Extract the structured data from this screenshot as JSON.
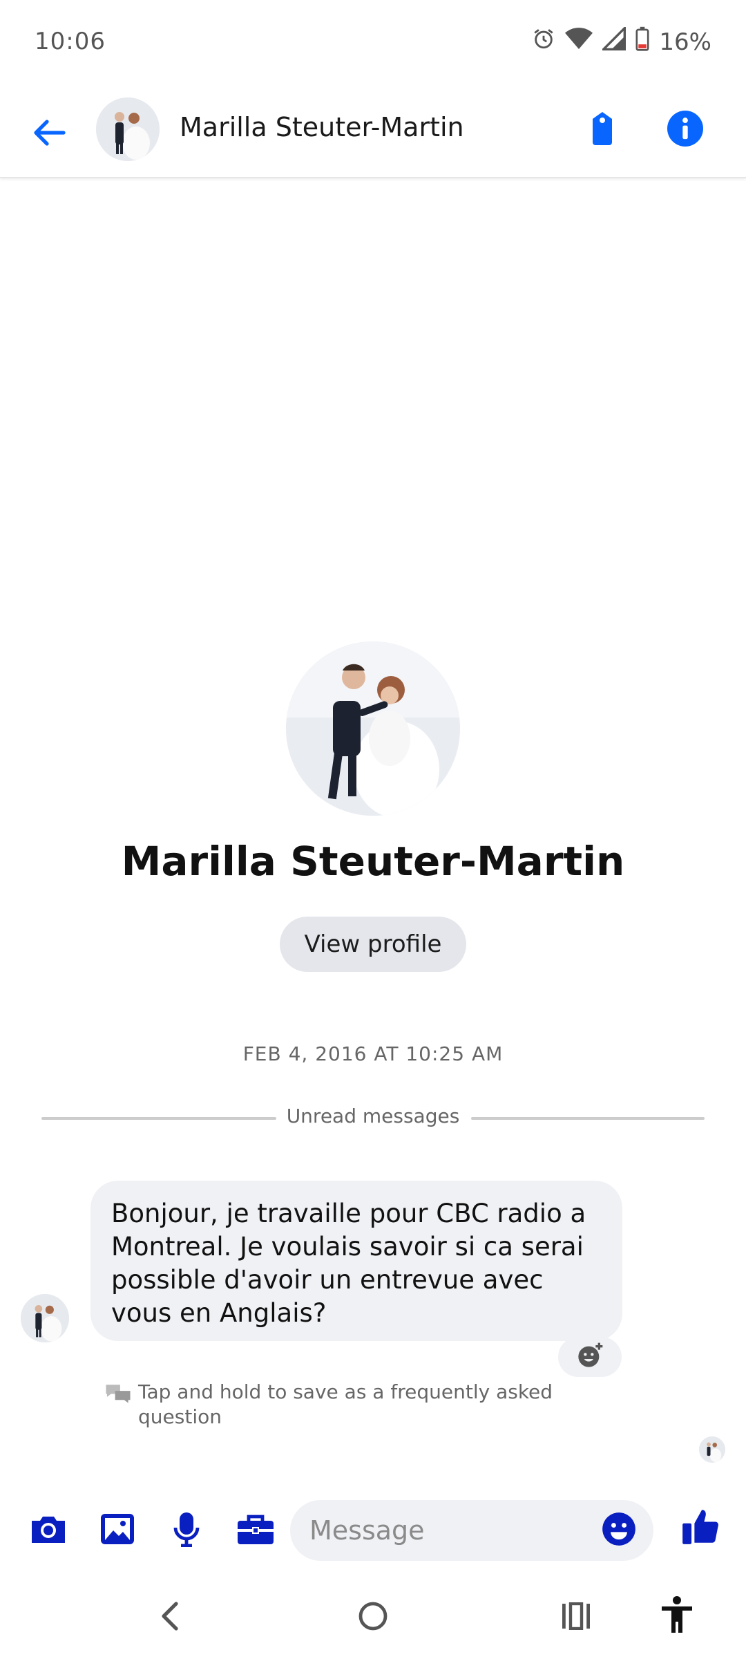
{
  "status_bar": {
    "time": "10:06",
    "battery": "16%",
    "icons": [
      "alarm-icon",
      "wifi-icon",
      "signal-icon",
      "battery-icon"
    ]
  },
  "header": {
    "title": "Marilla Steuter-Martin",
    "icons": [
      "back-arrow-icon",
      "tag-icon",
      "info-icon"
    ]
  },
  "profile": {
    "name": "Marilla Steuter-Martin",
    "view_profile_label": "View profile"
  },
  "conversation": {
    "timestamp": "FEB 4, 2016 AT 10:25 AM",
    "unread_label": "Unread messages",
    "messages": [
      {
        "text": "Bonjour, je travaille pour CBC radio a Montreal. Je voulais savoir si ca serai possible d'avoir un entrevue avec vous en Anglais?"
      }
    ],
    "faq_hint": "Tap and hold to save as a frequently asked question"
  },
  "composer": {
    "placeholder": "Message",
    "icons": [
      "camera-icon",
      "gallery-icon",
      "microphone-icon",
      "briefcase-icon",
      "emoji-icon",
      "thumbs-up-icon"
    ]
  },
  "colors": {
    "accent": "#0866ff",
    "composer_icon": "#0a1fbf",
    "bubble": "#f0f1f5",
    "button_bg": "#e4e6eb"
  }
}
